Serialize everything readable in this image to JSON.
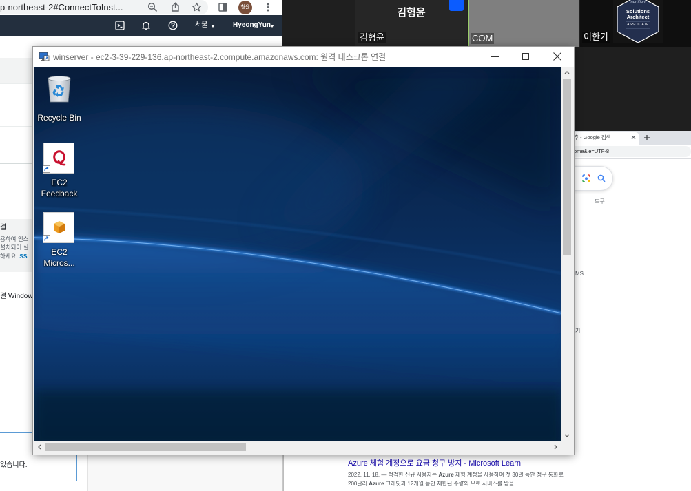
{
  "aws_browser": {
    "url": "p-northeast-2#ConnectToInst...",
    "avatar_initials": "형윤",
    "region": "서울",
    "username": "HyeongYun",
    "panel_heading": "결",
    "panel_lines": [
      "용하여 인스",
      "설치되어 실"
    ],
    "panel_last_text": "하세요. ",
    "panel_link": "SS",
    "windows_text": "결 Windows",
    "notice_text": "있습니다.",
    "icons": [
      "zoom-icon",
      "share-icon",
      "star-icon",
      "side-panel-icon",
      "more-icon",
      "cloudshell-icon",
      "bell-icon",
      "help-icon"
    ]
  },
  "meeting": {
    "tiles": [
      {
        "center_name": "김형윤",
        "label": "김형윤"
      },
      {
        "label": "COM"
      },
      {
        "label": "이한기"
      }
    ],
    "badge": {
      "line1": "certified",
      "line2": "Solutions",
      "line3": "Architect",
      "line4": "ASSOCIATE"
    }
  },
  "rdp": {
    "title": "winserver - ec2-3-39-229-136.ap-northeast-2.compute.amazonaws.com: 원격 데스크톱 연결",
    "desktop_icons": [
      {
        "icon": "recycle-bin-icon",
        "label_lines": [
          "Recycle Bin"
        ]
      },
      {
        "icon": "ec2-feedback-icon",
        "label_lines": [
          "EC2",
          "Feedback"
        ]
      },
      {
        "icon": "ec2-microsoft-icon",
        "label_lines": [
          "EC2",
          "Micros..."
        ]
      }
    ]
  },
  "google": {
    "tab_title": "추 - Google 검색",
    "url": "ome&ie=UTF-8",
    "tools": "도구",
    "fragments": [
      "MS",
      "기"
    ],
    "result": {
      "title": "Azure 체험 계정으로 요금 청구 방지 - Microsoft Learn",
      "snippet": [
        [
          {
            "text": "2022. 11. 18. — 적격한 신규 사용자는 ",
            "bold": false
          },
          {
            "text": "Azure",
            "bold": true
          },
          {
            "text": " 체험 계정을 사용하여 첫 30일 동안 청구 통화로",
            "bold": false
          }
        ],
        [
          {
            "text": "200달러 ",
            "bold": false
          },
          {
            "text": "Azure",
            "bold": true
          },
          {
            "text": " 크레딧과 12개월 동안 제한된 수량의 무료 서비스를 받을 ...",
            "bold": false
          }
        ]
      ]
    }
  },
  "colors": {
    "aws_nav": "#232f3e",
    "link": "#1a0dab",
    "wallpaper": "#0a2c5a"
  }
}
